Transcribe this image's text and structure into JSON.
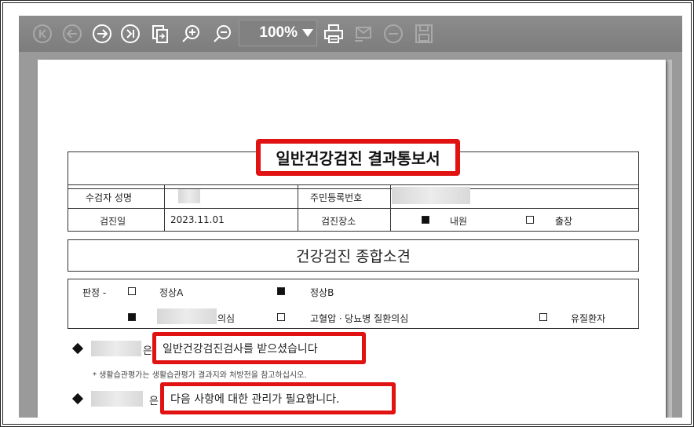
{
  "toolbar": {
    "zoom_value": "100%",
    "buttons": [
      "first-page",
      "previous-page",
      "next-page",
      "last-page",
      "copy-page",
      "zoom-in",
      "zoom-out",
      "print",
      "send",
      "remove",
      "save"
    ]
  },
  "document": {
    "title": "일반건강검진 결과통보서",
    "info": {
      "name_label": "수검자 성명",
      "id_label": "주민등록번호",
      "date_label": "검진일",
      "date_value": "2023.11.01",
      "place_label": "검진장소",
      "place_option_in": "내원",
      "place_option_out": "출장"
    },
    "summary_title": "건강검진 종합소견",
    "judgment": {
      "prefix": "판정 -",
      "normal_a": "정상A",
      "normal_b": "정상B",
      "suspect_suffix": "의심",
      "hypertension": "고혈압ㆍ당뇨병 질환의심",
      "patient": "유질환자"
    },
    "line1_particle": "은",
    "line1_highlight": "일반건강검진검사를 받으셨습니다",
    "line1_note": "* 생활습관평가는 생활습관평가 결과지와 처방전을 참고하십시오.",
    "line2_particle": "은",
    "line2_highlight": "다음 사항에 대한 관리가 필요합니다."
  },
  "colors": {
    "highlight": "#e11212",
    "toolbar": "#818181",
    "icon_active": "#ffffff",
    "icon_disabled": "#a9a9a9"
  }
}
